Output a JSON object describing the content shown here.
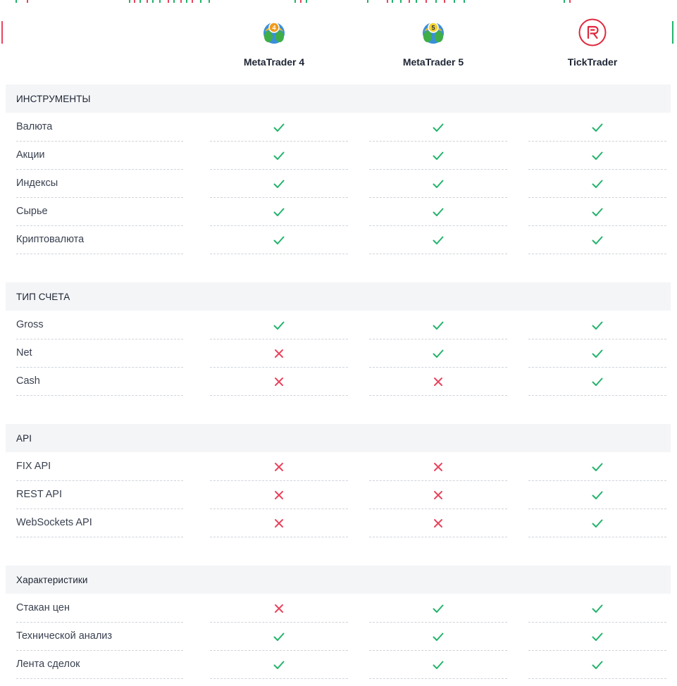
{
  "colors": {
    "check": "#22b36b",
    "cross": "#e8445e",
    "section_bg": "#f4f5f7",
    "divider": "#cfd3da",
    "tick_brand": "#e0273d"
  },
  "platforms": [
    {
      "name": "MetaTrader 4",
      "icon": "metatrader4-logo-icon"
    },
    {
      "name": "MetaTrader 5",
      "icon": "metatrader5-logo-icon"
    },
    {
      "name": "TickTrader",
      "icon": "ticktrader-logo-icon"
    }
  ],
  "sections": [
    {
      "title": "ИНСТРУМЕНТЫ",
      "rows": [
        {
          "label": "Валюта",
          "values": [
            true,
            true,
            true
          ]
        },
        {
          "label": "Акции",
          "values": [
            true,
            true,
            true
          ]
        },
        {
          "label": "Индексы",
          "values": [
            true,
            true,
            true
          ]
        },
        {
          "label": "Сырье",
          "values": [
            true,
            true,
            true
          ]
        },
        {
          "label": "Криптовалюта",
          "values": [
            true,
            true,
            true
          ]
        }
      ]
    },
    {
      "title": "ТИП СЧЕТА",
      "rows": [
        {
          "label": "Gross",
          "values": [
            true,
            true,
            true
          ]
        },
        {
          "label": "Net",
          "values": [
            false,
            true,
            true
          ]
        },
        {
          "label": "Cash",
          "values": [
            false,
            false,
            true
          ]
        }
      ]
    },
    {
      "title": "API",
      "rows": [
        {
          "label": "FIX API",
          "values": [
            false,
            false,
            true
          ]
        },
        {
          "label": "REST API",
          "values": [
            false,
            false,
            true
          ]
        },
        {
          "label": "WebSockets API",
          "values": [
            false,
            false,
            true
          ]
        }
      ]
    },
    {
      "title": "Характеристики",
      "rows": [
        {
          "label": "Стакан цен",
          "values": [
            false,
            true,
            true
          ]
        },
        {
          "label": "Технической анализ",
          "values": [
            true,
            true,
            true
          ]
        },
        {
          "label": "Лента сделок",
          "values": [
            true,
            true,
            true
          ]
        }
      ]
    }
  ]
}
